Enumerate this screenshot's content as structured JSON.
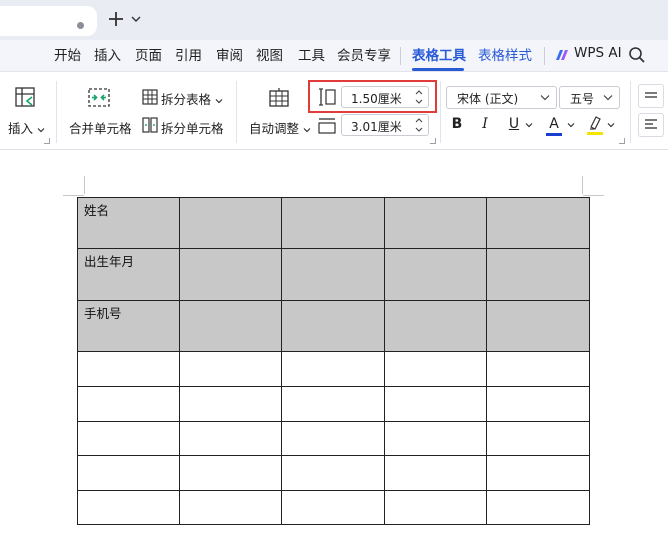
{
  "titlebar": {
    "new_tab": "+",
    "icons": [
      "tab-dot",
      "plus-icon",
      "chevron-down-icon"
    ]
  },
  "menu": {
    "items": [
      "开始",
      "插入",
      "页面",
      "引用",
      "审阅",
      "视图",
      "工具",
      "会员专享",
      "表格工具",
      "表格样式"
    ],
    "active": "表格工具",
    "wps_ai": "WPS AI",
    "accent_color": "#2a5bd7"
  },
  "ribbon": {
    "insert_label": "插入",
    "merge_cells_label": "合并单元格",
    "split_table_label": "拆分表格",
    "split_cells_label": "拆分单元格",
    "auto_adjust_label": "自动调整",
    "row_height_value": "1.50厘米",
    "col_width_value": "3.01厘米",
    "font_name": "宋体 (正文)",
    "font_size": "五号",
    "bold": "B",
    "italic": "I",
    "underline": "U",
    "font_color": "A",
    "highlight_color_name": "yellow",
    "font_color_hex": "#1a3fcf",
    "highlight_hex": "#f5e400"
  },
  "table": {
    "rows": [
      {
        "cells": [
          "姓名",
          "",
          "",
          "",
          ""
        ],
        "shaded": true
      },
      {
        "cells": [
          "出生年月",
          "",
          "",
          "",
          ""
        ],
        "shaded": true
      },
      {
        "cells": [
          "手机号",
          "",
          "",
          "",
          ""
        ],
        "shaded": true
      },
      {
        "cells": [
          "",
          "",
          "",
          "",
          ""
        ],
        "shaded": false
      },
      {
        "cells": [
          "",
          "",
          "",
          "",
          ""
        ],
        "shaded": false
      },
      {
        "cells": [
          "",
          "",
          "",
          "",
          ""
        ],
        "shaded": false
      },
      {
        "cells": [
          "",
          "",
          "",
          "",
          ""
        ],
        "shaded": false
      },
      {
        "cells": [
          "",
          "",
          "",
          "",
          ""
        ],
        "shaded": false
      }
    ],
    "shade_color": "#c8c8c8"
  },
  "annotation": {
    "highlight_color": "#e23b3b"
  }
}
